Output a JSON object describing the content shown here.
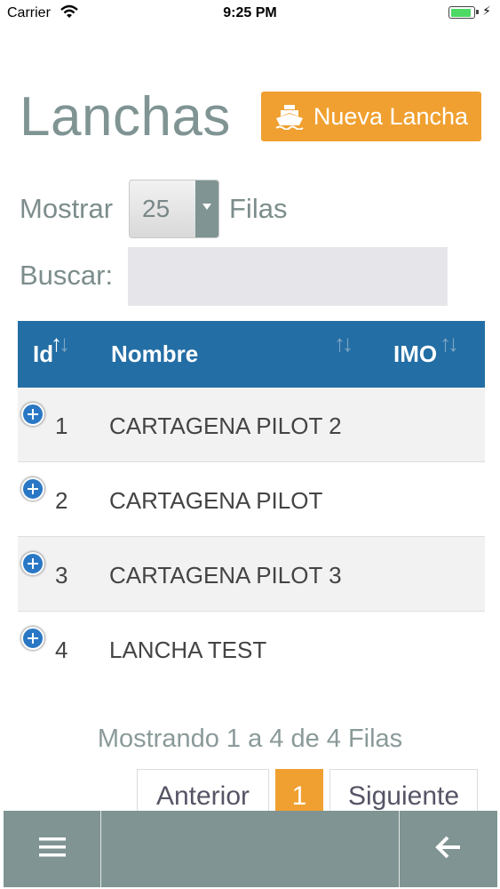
{
  "status_bar": {
    "carrier": "Carrier",
    "time": "9:25 PM"
  },
  "header": {
    "title": "Lanchas",
    "new_button_label": "Nueva Lancha",
    "new_button_icon": "ship-icon"
  },
  "controls": {
    "show_label": "Mostrar",
    "rows_value": "25",
    "rows_suffix": "Filas",
    "search_label": "Buscar:",
    "search_value": ""
  },
  "table": {
    "columns": [
      "Id",
      "Nombre",
      "IMO"
    ],
    "rows": [
      {
        "id": "1",
        "nombre": "CARTAGENA PILOT 2"
      },
      {
        "id": "2",
        "nombre": "CARTAGENA PILOT"
      },
      {
        "id": "3",
        "nombre": "CARTAGENA PILOT 3"
      },
      {
        "id": "4",
        "nombre": "LANCHA TEST"
      }
    ]
  },
  "info": "Mostrando 1 a 4 de 4 Filas",
  "pagination": {
    "prev": "Anterior",
    "current": "1",
    "next": "Siguiente"
  },
  "toolbar": {
    "menu_icon": "hamburger-menu-icon",
    "back_icon": "arrow-left-icon"
  },
  "colors": {
    "accent": "#f0a030",
    "header_blue": "#236ea5",
    "toolbar": "#7f9493"
  }
}
